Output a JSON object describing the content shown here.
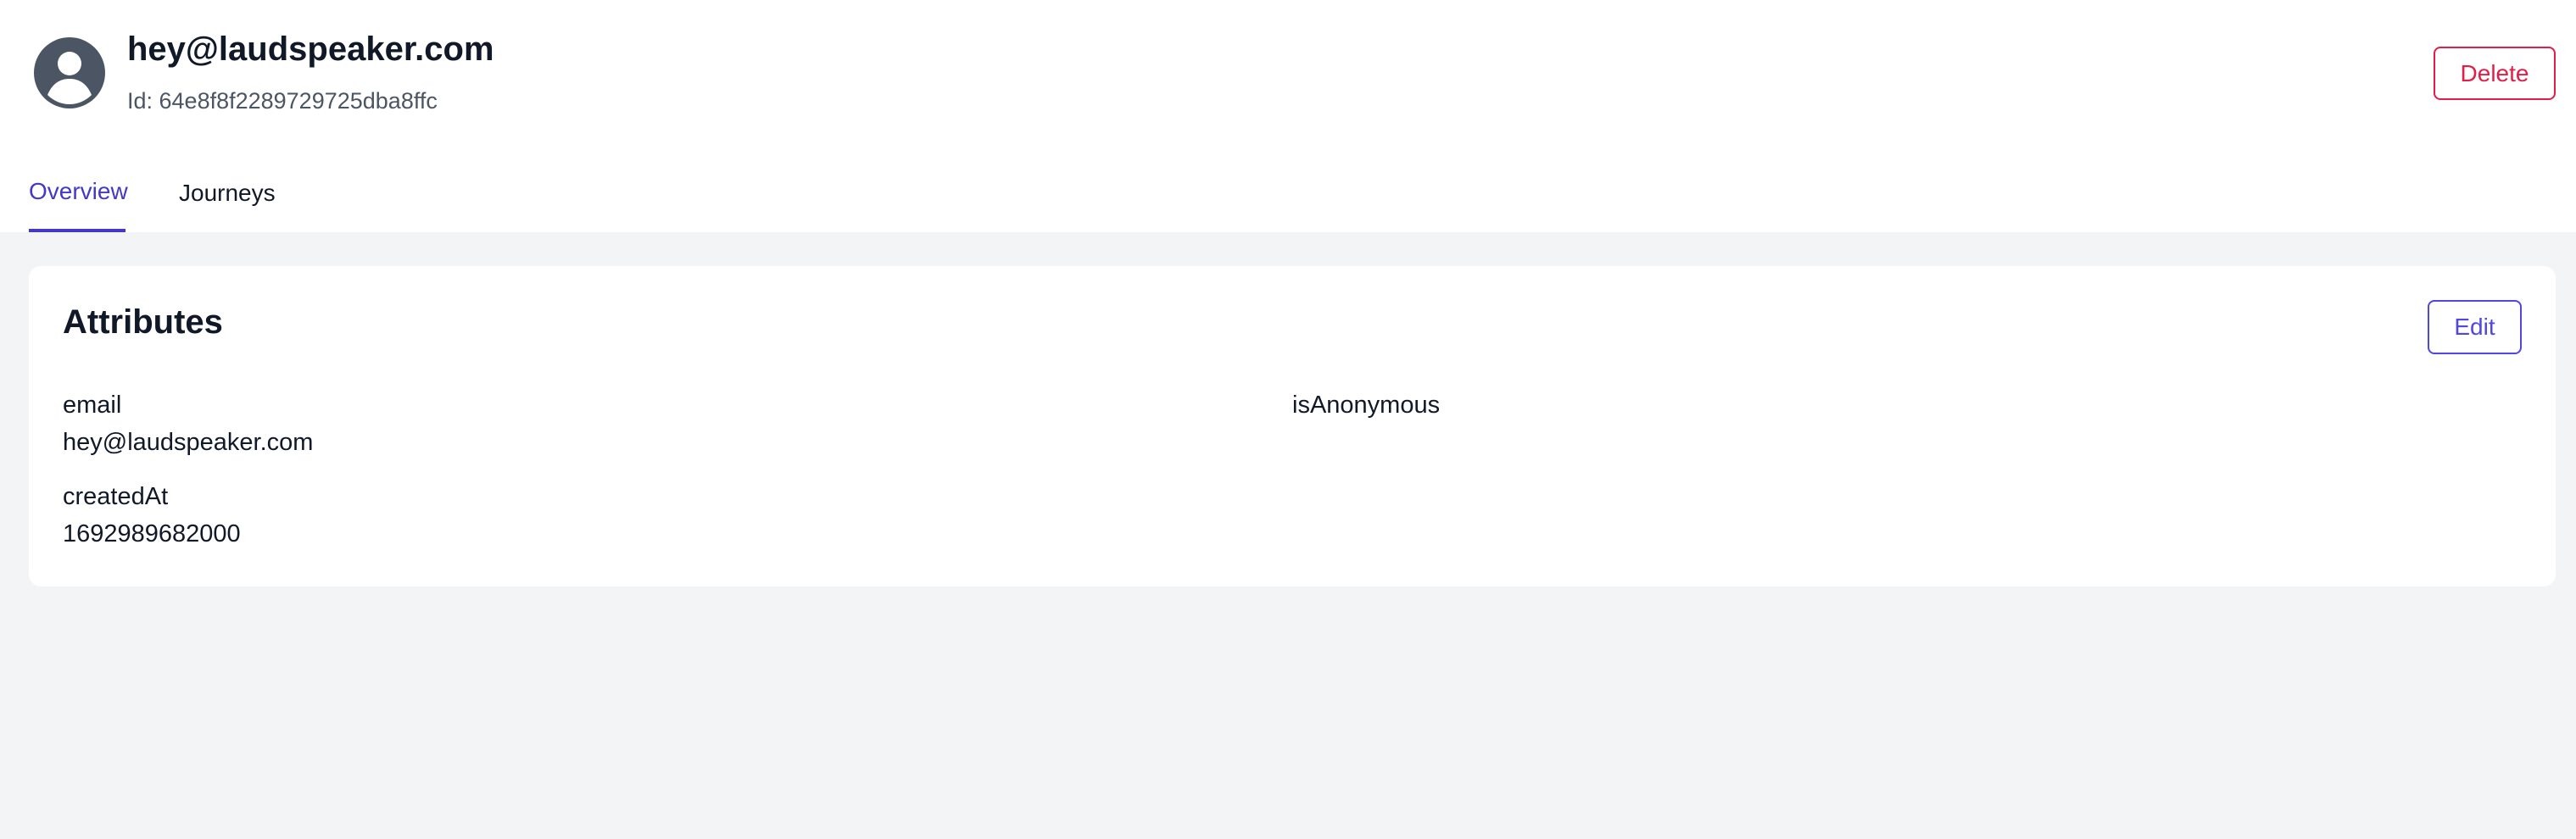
{
  "header": {
    "title": "hey@laudspeaker.com",
    "id_text": "Id: 64e8f8f2289729725dba8ffc",
    "delete_label": "Delete",
    "avatar_icon": "user-circle-icon"
  },
  "tabs": [
    {
      "label": "Overview",
      "active": true
    },
    {
      "label": "Journeys",
      "active": false
    }
  ],
  "attributes_card": {
    "title": "Attributes",
    "edit_label": "Edit",
    "items": [
      {
        "key": "email",
        "value": "hey@laudspeaker.com"
      },
      {
        "key": "isAnonymous",
        "value": ""
      },
      {
        "key": "createdAt",
        "value": "1692989682000"
      }
    ]
  },
  "colors": {
    "accent": "#4338ca",
    "edit": "#4f46e5",
    "danger": "#e11d48",
    "background": "#f3f4f6",
    "avatar": "#4b5563"
  }
}
